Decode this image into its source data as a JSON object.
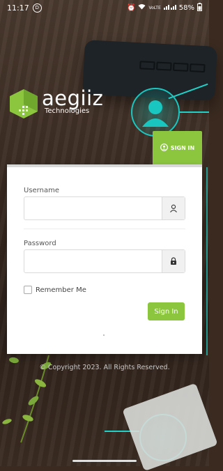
{
  "status_bar": {
    "time": "11:17",
    "badge_letter": "D",
    "network": "VoLTE",
    "battery": "58%"
  },
  "brand": {
    "name": "aegiiz",
    "subtitle": "Technologies",
    "color": "#8cc63f"
  },
  "tab": {
    "label": "SIGN IN"
  },
  "form": {
    "username_label": "Username",
    "username_value": "",
    "password_label": "Password",
    "password_value": "",
    "remember_label": "Remember Me",
    "remember_checked": false,
    "submit_label": "Sign In"
  },
  "footer": {
    "copyright": "© Copyright 2023. All Rights Reserved."
  },
  "icons": [
    "user-icon",
    "lock-icon",
    "signin-user-icon",
    "wifi-icon",
    "signal-icon",
    "battery-icon",
    "alarm-icon"
  ],
  "colors": {
    "accent": "#8cc63f",
    "network_teal": "#1fd1c8"
  }
}
